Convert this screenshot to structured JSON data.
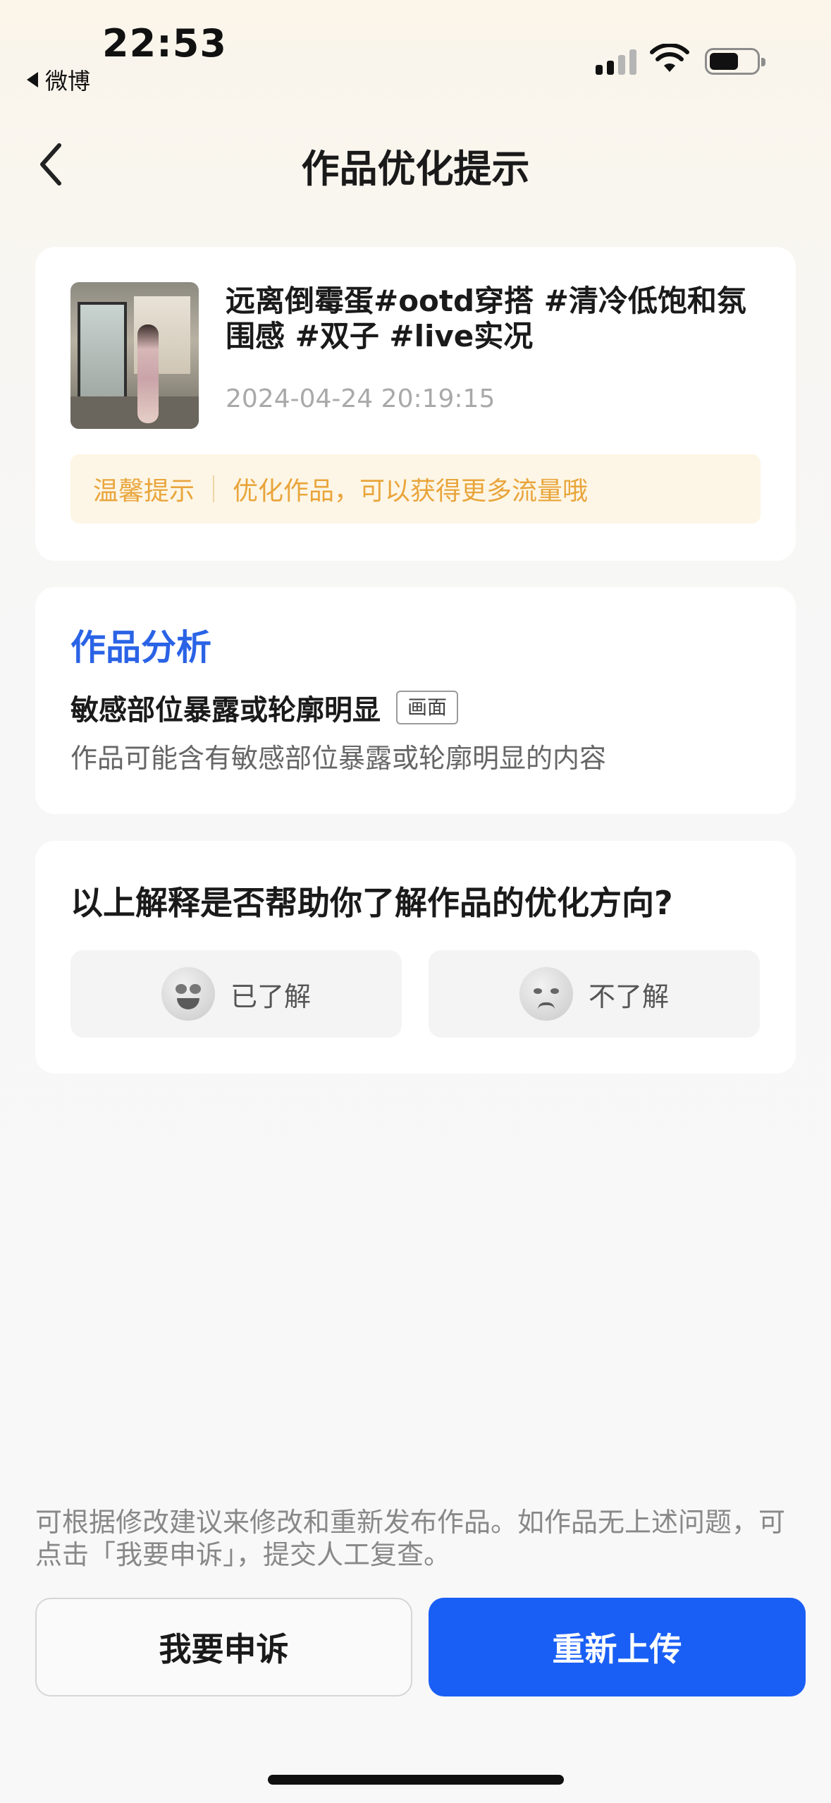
{
  "status_bar": {
    "time": "22:53",
    "back_app": "微博"
  },
  "header": {
    "title": "作品优化提示"
  },
  "post": {
    "title": "远离倒霉蛋#ootd穿搭 #清冷低饱和氛围感 #双子 #live实况",
    "timestamp": "2024-04-24 20:19:15",
    "tip_label": "温馨提示",
    "tip_text": "优化作品，可以获得更多流量哦"
  },
  "analysis": {
    "section_title": "作品分析",
    "issue_title": "敏感部位暴露或轮廓明显",
    "issue_tag": "画面",
    "issue_desc": "作品可能含有敏感部位暴露或轮廓明显的内容"
  },
  "feedback": {
    "question": "以上解释是否帮助你了解作品的优化方向?",
    "option_yes": "已了解",
    "option_no": "不了解"
  },
  "footer": {
    "note": "可根据修改建议来修改和重新发布作品。如作品无上述问题，可点击「我要申诉」，提交人工复查。",
    "appeal_label": "我要申诉",
    "reupload_label": "重新上传"
  },
  "colors": {
    "accent_blue": "#1a5ff5",
    "section_blue": "#2a63e6",
    "tip_orange": "#e9a53b"
  }
}
